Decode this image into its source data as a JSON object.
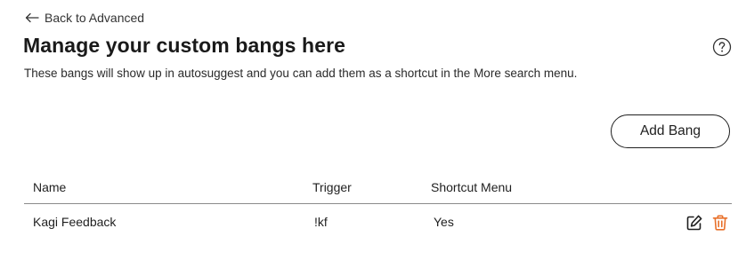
{
  "nav": {
    "back_label": "Back to Advanced"
  },
  "header": {
    "title": "Manage your custom bangs here",
    "subtitle": "These bangs will show up in autosuggest and you can add them as a shortcut in the More search menu.",
    "help_icon": "help-circle-icon"
  },
  "toolbar": {
    "add_label": "Add Bang"
  },
  "table": {
    "columns": [
      "Name",
      "Trigger",
      "Shortcut Menu"
    ],
    "rows": [
      {
        "name": "Kagi Feedback",
        "trigger": "!kf",
        "shortcut": "Yes"
      }
    ]
  },
  "icons": {
    "back": "arrow-left-icon",
    "edit": "edit-icon",
    "delete": "trash-icon"
  },
  "colors": {
    "delete_icon": "#e8702a",
    "text": "#1f1f1f"
  }
}
